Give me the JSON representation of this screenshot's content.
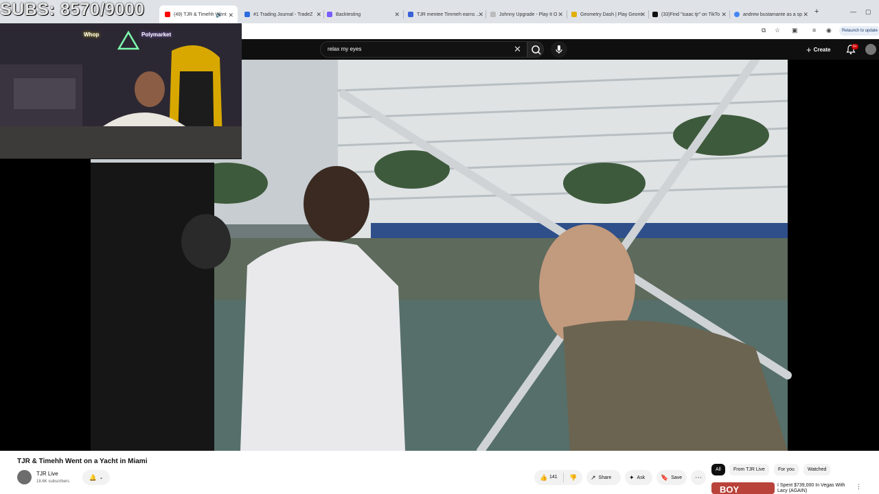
{
  "overlay": {
    "subs_counter": "SUBS: 8570/9000"
  },
  "webcam": {
    "sponsor_left": "Whop",
    "sponsor_right": "Polymarket"
  },
  "tabs": [
    {
      "label": "(49) TJR & Timehh Went",
      "icon": "youtube-icon",
      "color": "#ff0000",
      "active": true
    },
    {
      "label": "#1 Trading Journal - TradeZ",
      "icon": "trading-journal-icon",
      "color": "#2d6cdf"
    },
    {
      "label": "Backtesting",
      "icon": "backtesting-icon",
      "color": "#7b5cff"
    },
    {
      "label": "TJR mentee Timmeh earns ...",
      "icon": "tjr-icon",
      "color": "#3a61d8"
    },
    {
      "label": "Johnny Upgrade - Play It O",
      "icon": "game-icon",
      "color": "#bbbbbb"
    },
    {
      "label": "Geometry Dash | Play Geom",
      "icon": "geometry-dash-icon",
      "color": "#e0b000"
    },
    {
      "label": "(33)Find \"isaac tjr\" on TikTo",
      "icon": "tiktok-icon",
      "color": "#111111"
    },
    {
      "label": "andrew bustamante as a sp",
      "icon": "google-icon",
      "color": "#4285f4"
    }
  ],
  "browser": {
    "relaunch_label": "Relaunch to update"
  },
  "youtube": {
    "search_value": "relax my eyes",
    "create_label": "Create",
    "notification_count": "9+"
  },
  "video": {
    "title": "TJR & Timehh Went on a Yacht in Miami",
    "channel_name": "TJR Live",
    "subscribers": "18.6K subscribers",
    "likes": "141",
    "share_label": "Share",
    "ask_label": "Ask",
    "save_label": "Save"
  },
  "filter_chips": [
    "All",
    "From TJR Live",
    "For you",
    "Watched"
  ],
  "recommendation": {
    "thumb_text": "BOY",
    "title": "I Spent $739,000 In Vegas With Lacy (AGAIN)"
  }
}
